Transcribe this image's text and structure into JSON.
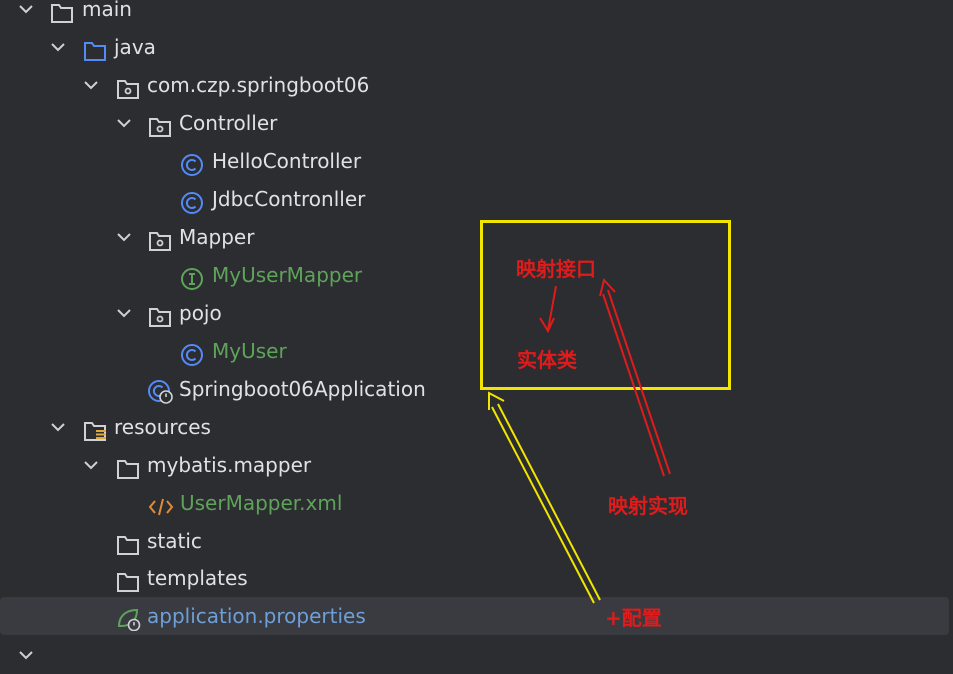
{
  "tree": {
    "main": "main",
    "java": "java",
    "package": "com.czp.springboot06",
    "controller": "Controller",
    "hello_controller": "HelloController",
    "jdbc_controller": "JdbcContronller",
    "mapper": "Mapper",
    "my_user_mapper": "MyUserMapper",
    "pojo": "pojo",
    "my_user": "MyUser",
    "application_class": "Springboot06Application",
    "resources": "resources",
    "mybatis_mapper": "mybatis.mapper",
    "user_mapper_xml": "UserMapper.xml",
    "static": "static",
    "templates": "templates",
    "application_properties": "application.properties"
  },
  "annotations": {
    "mapping_interface": "映射接口",
    "entity_class": "实体类",
    "mapping_impl": "映射实现",
    "plus_config": "+配置"
  },
  "colors": {
    "background": "#2b2d30",
    "selected_row": "#393b40",
    "annotation_red": "#e01b1b",
    "annotation_yellow": "#f2e500",
    "class_icon": "#548af7",
    "interface_icon": "#5fa35a"
  }
}
